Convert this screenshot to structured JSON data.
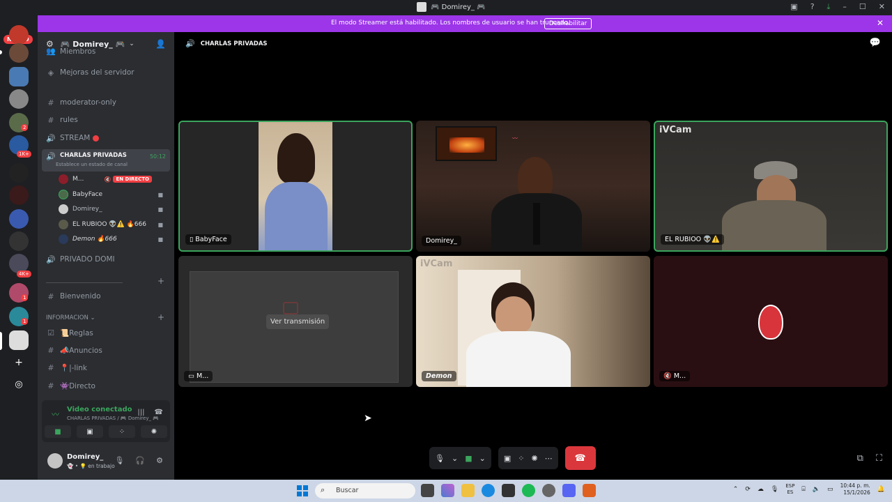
{
  "window": {
    "title": "🎮 Domirey_ 🎮"
  },
  "banner": {
    "text": "El modo Streamer está habilitado. Los nombres de usuario se han truncado.",
    "button_label": "Deshabilitar"
  },
  "guilds": {
    "new_label": "NUEVO",
    "badges": [
      "2",
      "1K+",
      "4K+",
      "1",
      "1"
    ]
  },
  "server": {
    "name": "🎮 Domirey_ 🎮",
    "partial_item": "Miembros",
    "boost_label": "Mejoras del servidor"
  },
  "channels": {
    "text1": "moderator-only",
    "text2": "rules",
    "voice_stream": "STREAM",
    "active": {
      "name": "CHARLAS PRIVADAS",
      "sub": "Establece un estado de canal",
      "time": "50:12"
    },
    "voice_users": [
      {
        "name": "M...",
        "live_label": "EN DIRECTO"
      },
      {
        "name": "BabyFace"
      },
      {
        "name": "Domirey_"
      },
      {
        "name": "EL RUBIOO 👽⚠️ 🔥666"
      },
      {
        "name": "Demon 🔥666"
      }
    ],
    "voice_private": "PRIVADO DOMI",
    "welcome": "Bienvenido",
    "category_info": "INFORMACION",
    "rules": "📜Reglas",
    "announcements": "📣Anuncios",
    "link": "📍|-link",
    "direct": "👾Directo"
  },
  "voice_panel": {
    "status": "Video conectado",
    "location": "CHARLAS PRIVADAS / 🎮 Domirey_ 🎮"
  },
  "user_panel": {
    "name": "Domirey_",
    "status": "en trabajo"
  },
  "call": {
    "title": "CHARLAS PRIVADAS",
    "tiles": [
      {
        "label": "BabyFace"
      },
      {
        "label": "Domirey_"
      },
      {
        "label": "EL RUBIOO 👽⚠️",
        "watermark": "iVCam"
      },
      {
        "label": "M...",
        "watch_label": "Ver transmisión"
      },
      {
        "label": "Demon",
        "watermark": "iVCam"
      },
      {
        "label": "M..."
      }
    ]
  },
  "taskbar": {
    "search_placeholder": "Buscar",
    "lang_top": "ESP",
    "lang_bottom": "ES",
    "time": "10:44 p. m.",
    "date": "15/1/2026"
  },
  "colors": {
    "accent_green": "#3ba55d",
    "banner_purple": "#9c36e8",
    "danger_red": "#da373c",
    "sidebar": "#2b2d31"
  }
}
